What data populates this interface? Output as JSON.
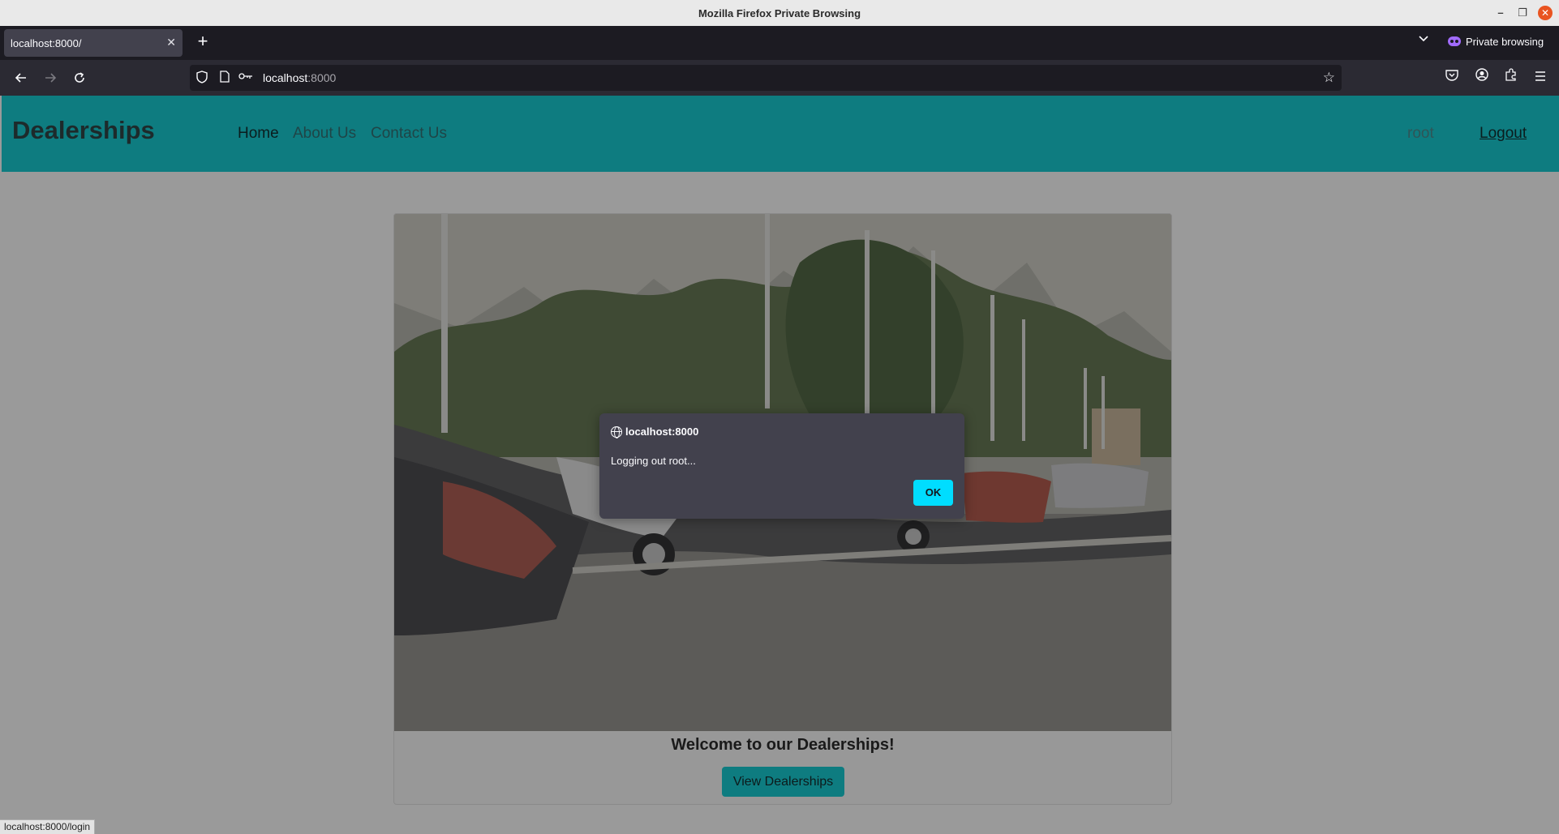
{
  "window": {
    "title": "Mozilla Firefox Private Browsing"
  },
  "tabs": [
    {
      "title": "localhost:8000/"
    }
  ],
  "browser": {
    "url_host": "localhost",
    "url_port": ":8000",
    "private_label": "Private browsing"
  },
  "site": {
    "brand": "Dealerships",
    "nav": [
      "Home",
      "About Us",
      "Contact Us"
    ],
    "user": "root",
    "logout": "Logout"
  },
  "card": {
    "title": "Welcome to our Dealerships!",
    "button": "View Dealerships"
  },
  "dialog": {
    "origin": "localhost:8000",
    "message": "Logging out root...",
    "ok_label": "OK"
  },
  "status_url": "localhost:8000/login"
}
